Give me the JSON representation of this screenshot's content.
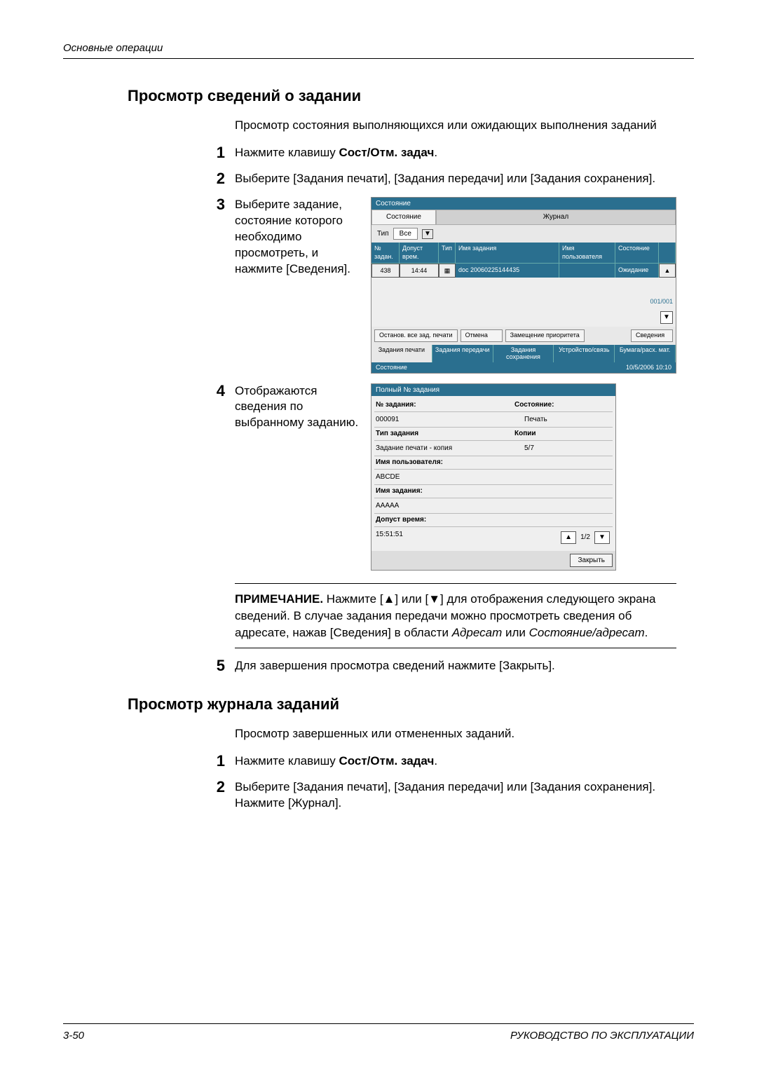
{
  "running_head": "Основные операции",
  "section1": {
    "title": "Просмотр сведений о задании",
    "intro": "Просмотр состояния выполняющихся или ожидающих выполнения заданий",
    "steps": {
      "s1_a": "Нажмите клавишу ",
      "s1_b": "Сост/Отм. задач",
      "s1_c": ".",
      "s2": "Выберите [Задания печати], [Задания передачи] или [Задания сохранения].",
      "s3": "Выберите задание, состояние которого необходимо просмотреть, и нажмите [Сведения].",
      "s4": "Отображаются сведения по выбранному заданию.",
      "s5": "Для завершения просмотра сведений нажмите [Закрыть]."
    }
  },
  "note": {
    "label": "ПРИМЕЧАНИЕ.",
    "body_a": " Нажмите [▲] или [▼] для отображения следующего экрана сведений. В случае задания передачи можно просмотреть сведения об адресате, нажав [Сведения] в области ",
    "ital1": "Адресат",
    "mid": " или ",
    "ital2": "Состояние/адресат",
    "end": "."
  },
  "section2": {
    "title": "Просмотр журнала заданий",
    "intro": "Просмотр завершенных или отмененных заданий.",
    "s1_a": "Нажмите клавишу ",
    "s1_b": "Сост/Отм. задач",
    "s1_c": ".",
    "s2": "Выберите [Задания печати], [Задания передачи] или [Задания сохранения]. Нажмите [Журнал]."
  },
  "screenshot1": {
    "win": "Состояние",
    "tab_state": "Состояние",
    "tab_log": "Журнал",
    "filter_type": "Тип",
    "filter_all": "Все",
    "hdr": {
      "c1": "№ задан.",
      "c2": "Допуст врем.",
      "c3": "Тип",
      "c4": "Имя задания",
      "c5": "Имя пользователя",
      "c6": "Состояние"
    },
    "row": {
      "num": "438",
      "time": "14:44",
      "name": "doc 20060225144435",
      "state": "Ожидание"
    },
    "counter": "001/001",
    "btn_pause": "Останов. все зад. печати",
    "btn_cancel": "Отмена",
    "btn_prio": "Замещение приоритета",
    "btn_detail": "Сведения",
    "bt1": "Задания печати",
    "bt2": "Задания передачи",
    "bt3": "Задания сохранения",
    "bt4": "Устройство/связь",
    "bt5": "Бумага/расх. мат.",
    "foot_left": "Состояние",
    "foot_right": "10/5/2006    10:10"
  },
  "screenshot2": {
    "title": "Полный № задания",
    "lbl_jobno": "№ задания:",
    "val_jobno": "000091",
    "lbl_state": "Состояние:",
    "val_state": "Печать",
    "lbl_type": "Тип задания",
    "val_type": "Задание печати - копия",
    "lbl_copies": "Копии",
    "val_copies": "5/7",
    "lbl_user": "Имя пользователя:",
    "val_user": "ABCDE",
    "lbl_name": "Имя задания:",
    "val_name": "AAAAA",
    "lbl_time": "Допуст время:",
    "val_time": "15:51:51",
    "pager": "1/2",
    "close": "Закрыть"
  },
  "footer": {
    "left": "3-50",
    "right": "РУКОВОДСТВО ПО ЭКСПЛУАТАЦИИ"
  }
}
